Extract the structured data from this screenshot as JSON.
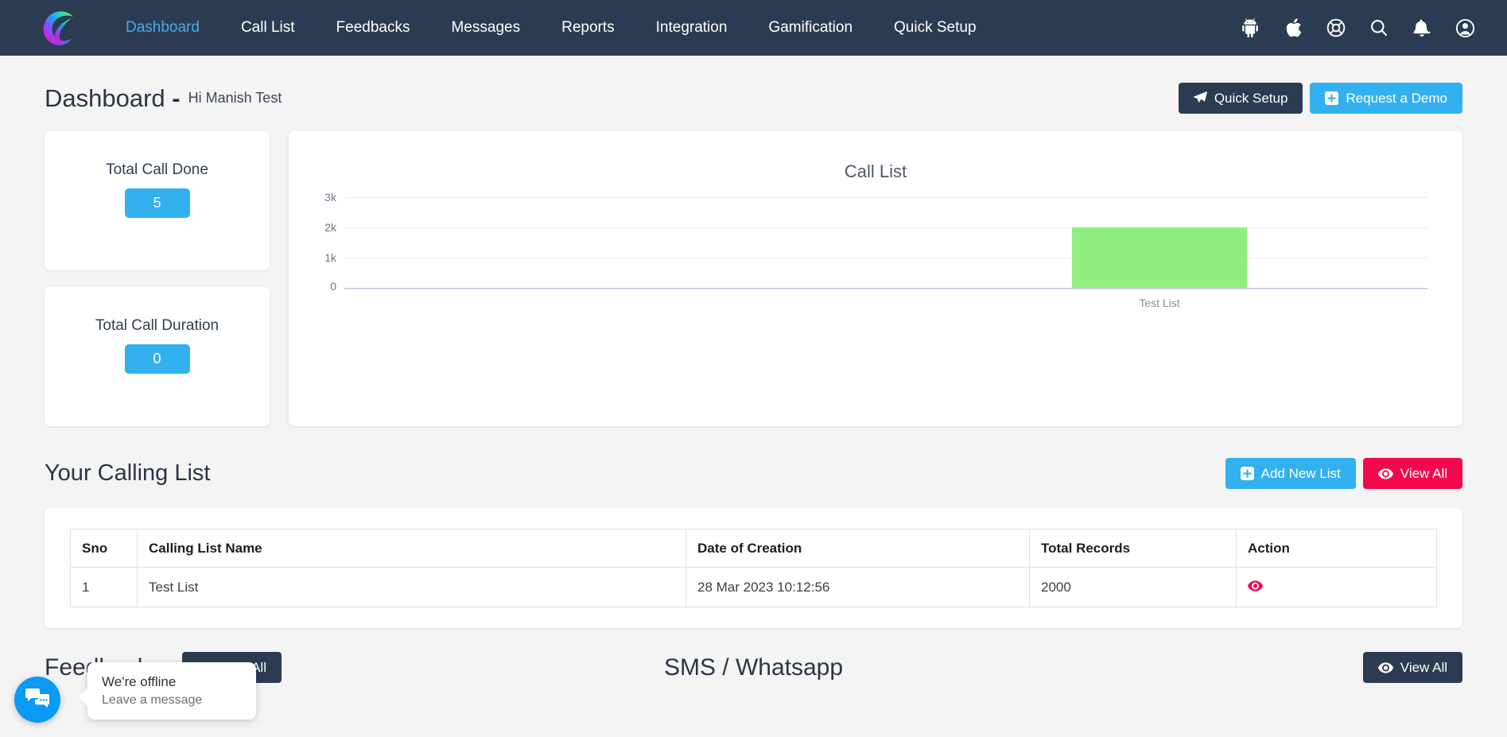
{
  "navbar": {
    "logo_name": "crm-logo",
    "links": [
      {
        "label": "Dashboard",
        "active": true
      },
      {
        "label": "Call List",
        "active": false
      },
      {
        "label": "Feedbacks",
        "active": false
      },
      {
        "label": "Messages",
        "active": false
      },
      {
        "label": "Reports",
        "active": false
      },
      {
        "label": "Integration",
        "active": false
      },
      {
        "label": "Gamification",
        "active": false
      },
      {
        "label": "Quick Setup",
        "active": false
      }
    ],
    "icons": [
      "android-icon",
      "apple-icon",
      "life-ring-icon",
      "search-icon",
      "bell-icon",
      "user-account-icon"
    ],
    "background_color": "#2b3c52",
    "active_link_color": "#4aa8e8"
  },
  "header": {
    "title": "Dashboard",
    "separator": "-",
    "greeting": "Hi Manish Test",
    "quick_setup_label": "Quick Setup",
    "request_demo_label": "Request a Demo",
    "quick_setup_color": "#2b3c52",
    "request_demo_color": "#33b0f0"
  },
  "stats": [
    {
      "label": "Total Call Done",
      "value": "5"
    },
    {
      "label": "Total Call Duration",
      "value": "0"
    }
  ],
  "chart_data": {
    "type": "bar",
    "title": "Call List",
    "categories": [
      "Test List"
    ],
    "values": [
      2000
    ],
    "series": [
      {
        "name": "Call List",
        "values": [
          2000
        ],
        "color": "#90ee7e"
      }
    ],
    "xlabel": "",
    "ylabel": "",
    "ylim": [
      0,
      4000
    ],
    "yticks": [
      0,
      1000,
      2000,
      3000
    ],
    "ytick_labels": [
      "0",
      "1k",
      "2k",
      "3k"
    ],
    "grid": true,
    "legend": false
  },
  "calling_list": {
    "section_title": "Your Calling List",
    "add_new_label": "Add New List",
    "view_all_label": "View All",
    "columns": [
      "Sno",
      "Calling List Name",
      "Date of Creation",
      "Total Records",
      "Action"
    ],
    "rows": [
      {
        "sno": "1",
        "name": "Test List",
        "date": "28 Mar 2023 10:12:56",
        "records": "2000",
        "action_icon": "eye-icon"
      }
    ]
  },
  "bottom": {
    "left_heading": "Feedbacks",
    "left_view_all_label": "View All",
    "center_heading": "SMS / Whatsapp",
    "right_view_all_label": "View All"
  },
  "chat_widget": {
    "title": "We're offline",
    "subtitle": "Leave a message",
    "icon": "chat-icon",
    "color": "#0a9bf5"
  }
}
